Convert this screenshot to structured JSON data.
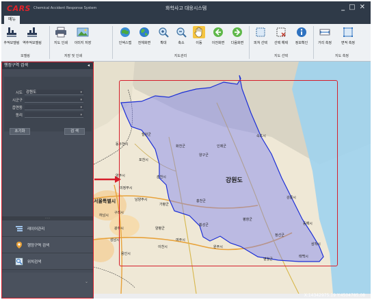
{
  "window": {
    "logo": "CARS",
    "logo_subtitle": "Chemical Accident Response System",
    "title": "화학사고 대응시스템",
    "controls": [
      "_",
      "□",
      "✕"
    ]
  },
  "menu": {
    "tab": "메뉴"
  },
  "ribbon": {
    "buttons": [
      {
        "label": "추적모델링",
        "icon": "tracking-model-icon"
      },
      {
        "label": "역추적모델링",
        "icon": "reverse-tracking-icon"
      },
      {
        "label": "지도 인쇄",
        "icon": "printer-icon"
      },
      {
        "label": "이미지 저장",
        "icon": "image-save-icon"
      },
      {
        "label": "인덱스맵",
        "icon": "index-map-icon"
      },
      {
        "label": "전체화면",
        "icon": "globe-icon"
      },
      {
        "label": "확대",
        "icon": "zoom-in-icon"
      },
      {
        "label": "축소",
        "icon": "zoom-out-icon"
      },
      {
        "label": "이동",
        "icon": "hand-pan-icon"
      },
      {
        "label": "이전화면",
        "icon": "back-icon"
      },
      {
        "label": "다음화면",
        "icon": "forward-icon"
      },
      {
        "label": "피쳐 선택",
        "icon": "feature-select-icon"
      },
      {
        "label": "선택 해제",
        "icon": "deselect-icon"
      },
      {
        "label": "정보확인",
        "icon": "info-icon"
      },
      {
        "label": "거리 측정",
        "icon": "distance-measure-icon"
      },
      {
        "label": "면적 측정",
        "icon": "area-measure-icon"
      }
    ],
    "groups": [
      "모델링",
      "저장 및 인쇄",
      "지도관리",
      "지도 선택",
      "지도 측정"
    ]
  },
  "leftpanel": {
    "header": "행정구역 검색",
    "pin": "◂",
    "fields": [
      {
        "label": "시도",
        "value": "강원도"
      },
      {
        "label": "시군구",
        "value": ""
      },
      {
        "label": "읍면동",
        "value": ""
      },
      {
        "label": "동리",
        "value": ""
      }
    ],
    "reset_button": "초기화",
    "search_button": "검 색",
    "splitter": "·····",
    "nav": [
      {
        "label": "레이어관리",
        "icon": "layer-icon"
      },
      {
        "label": "행정구역 검색",
        "icon": "map-pin-icon"
      },
      {
        "label": "위치검색",
        "icon": "location-search-icon"
      }
    ],
    "collapse": "⌄"
  },
  "map": {
    "region_label": "강원도",
    "places": [
      "동두천시",
      "포천시",
      "양주시",
      "의정부시",
      "남양주시",
      "서울특별시",
      "구리시",
      "하남시",
      "광주시",
      "성남시",
      "용인시",
      "이천시",
      "여주시",
      "양평군",
      "가평군",
      "춘천시",
      "홍천군",
      "원주시",
      "횡성군",
      "평창군",
      "영월군",
      "정선군",
      "강릉시",
      "동해시",
      "삼척시",
      "태백시",
      "속초시",
      "인제군",
      "양구군",
      "화천군",
      "철원군"
    ]
  },
  "status": {
    "coordinates": "X:14342975.19 Y:4504785.08"
  },
  "colors": {
    "titlebar": "#2f3a48",
    "ribbon": "#eef1f4",
    "panel": "#454c58",
    "highlight": "#d61d2a",
    "region_fill": "#7c83f2",
    "region_border": "#1c2fd6",
    "logo": "#e2222a"
  }
}
